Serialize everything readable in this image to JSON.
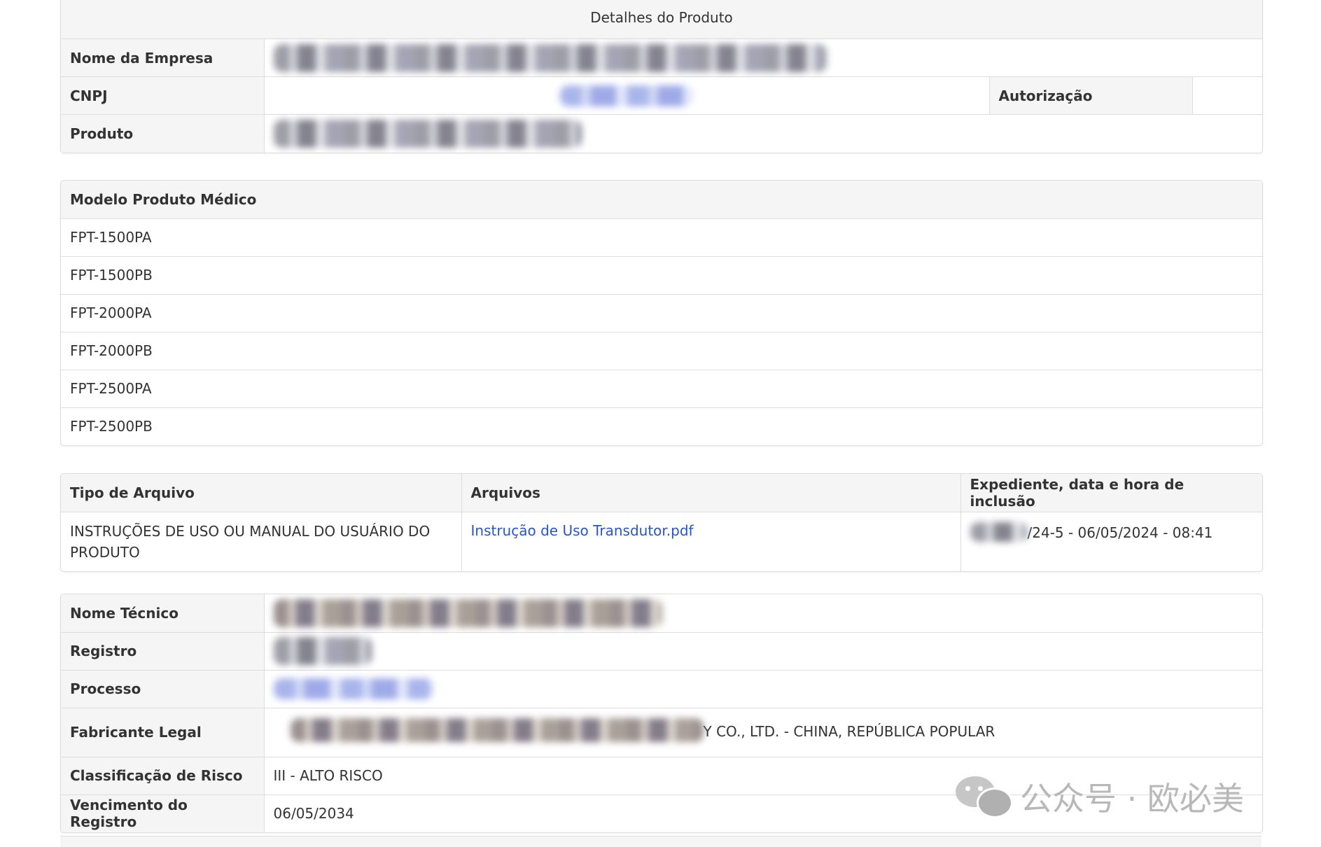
{
  "details": {
    "title": "Detalhes do Produto",
    "company_label": "Nome da Empresa",
    "cnpj_label": "CNPJ",
    "authorization_label": "Autorização",
    "product_label": "Produto"
  },
  "models": {
    "header": "Modelo Produto Médico",
    "items": [
      "FPT-1500PA",
      "FPT-1500PB",
      "FPT-2000PA",
      "FPT-2000PB",
      "FPT-2500PA",
      "FPT-2500PB"
    ]
  },
  "files": {
    "headers": [
      "Tipo de Arquivo",
      "Arquivos",
      "Expediente, data e hora de inclusão"
    ],
    "rows": [
      {
        "type": "INSTRUÇÕES DE USO OU MANUAL DO USUÁRIO DO PRODUTO",
        "file": "Instrução de Uso Transdutor.pdf",
        "expediente": "/24-5 - 06/05/2024 - 08:41"
      }
    ]
  },
  "tech": {
    "technical_name_label": "Nome Técnico",
    "registry_label": "Registro",
    "process_label": "Processo",
    "manufacturer_label": "Fabricante Legal",
    "manufacturer_value": "Y CO., LTD. - CHINA, REPÚBLICA POPULAR",
    "risk_label": "Classificação de Risco",
    "risk_value": "III - ALTO RISCO",
    "expiry_label": "Vencimento do Registro",
    "expiry_value": "06/05/2034"
  },
  "watermark": {
    "text": "公众号 · 欧必美"
  }
}
